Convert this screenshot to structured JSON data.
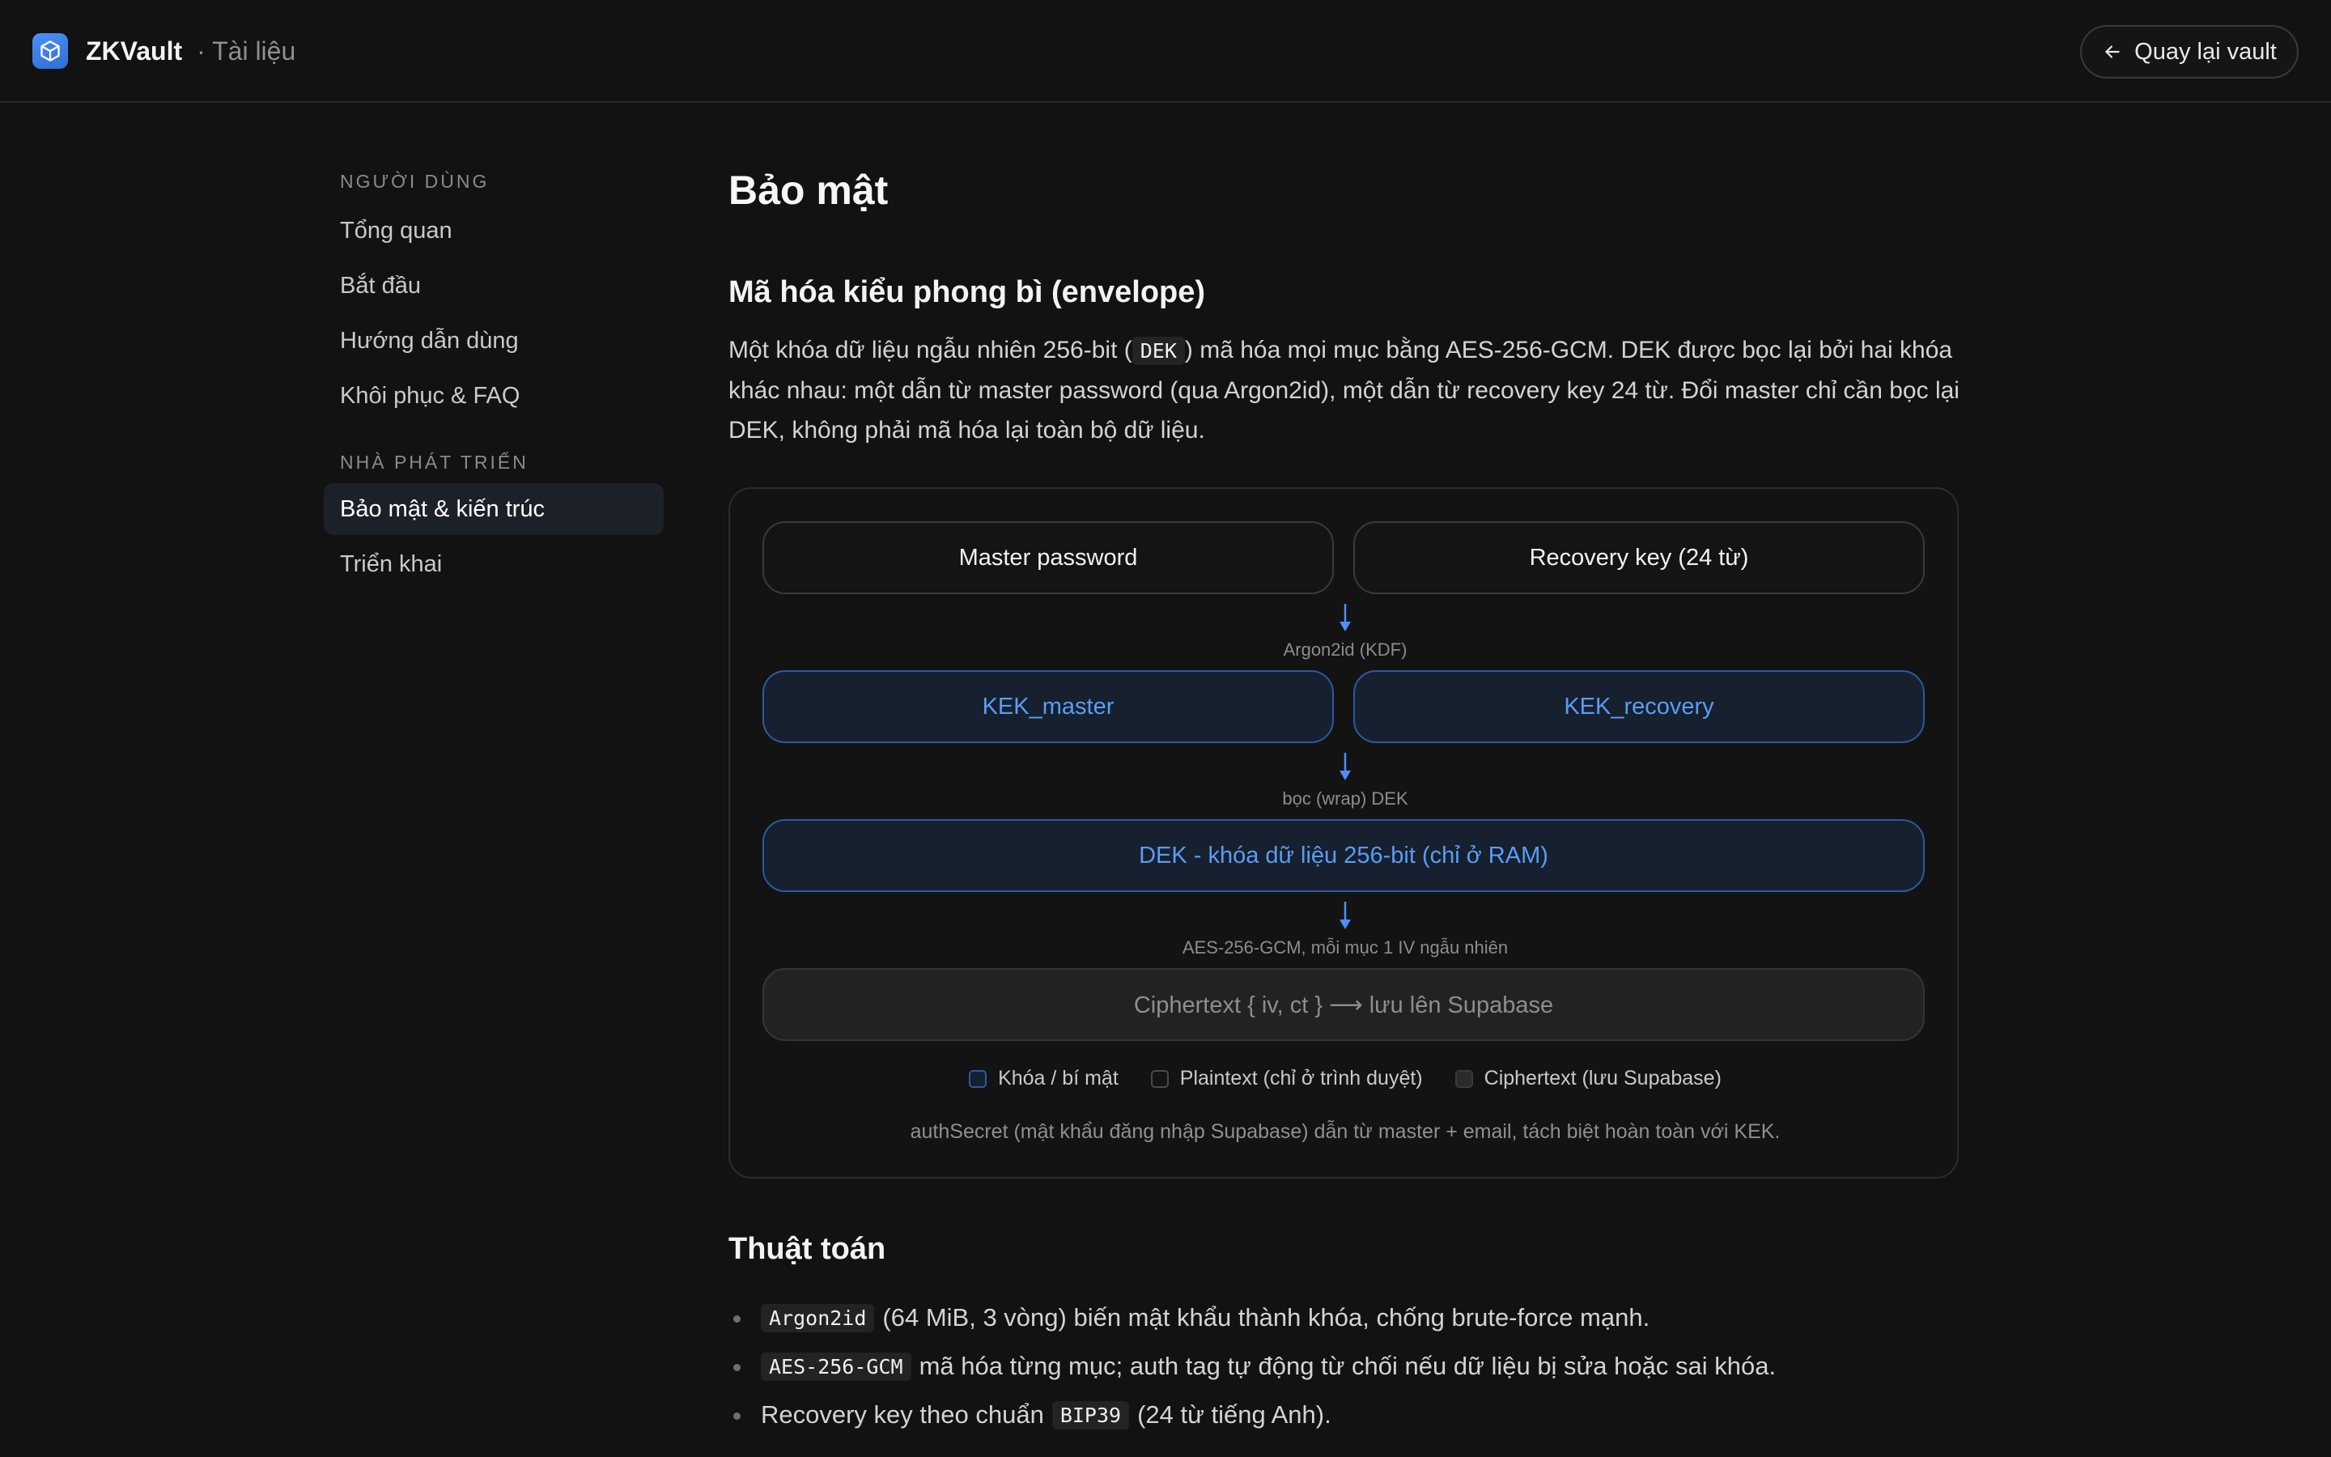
{
  "header": {
    "brand": "ZKVault",
    "section": "· Tài liệu",
    "back_label": "Quay lại vault"
  },
  "sidebar": {
    "groups": [
      {
        "title": "NGƯỜI DÙNG",
        "items": [
          "Tổng quan",
          "Bắt đầu",
          "Hướng dẫn dùng",
          "Khôi phục & FAQ"
        ]
      },
      {
        "title": "NHÀ PHÁT TRIỂN",
        "items": [
          "Bảo mật & kiến trúc",
          "Triển khai"
        ]
      }
    ],
    "active_item": "Bảo mật & kiến trúc"
  },
  "main": {
    "title": "Bảo mật",
    "envelope": {
      "heading": "Mã hóa kiểu phong bì (envelope)",
      "para_before_code": "Một khóa dữ liệu ngẫu nhiên 256-bit (",
      "code": "DEK",
      "para_after_code": ") mã hóa mọi mục bằng AES-256-GCM. DEK được bọc lại bởi hai khóa khác nhau: một dẫn từ master password (qua Argon2id), một dẫn từ recovery key 24 từ. Đổi master chỉ cần bọc lại DEK, không phải mã hóa lại toàn bộ dữ liệu."
    },
    "diagram": {
      "master_password": "Master password",
      "recovery_key": "Recovery key (24 từ)",
      "step1_label": "Argon2id (KDF)",
      "kek_master": "KEK_master",
      "kek_recovery": "KEK_recovery",
      "step2_label": "bọc (wrap) DEK",
      "dek": "DEK - khóa dữ liệu 256-bit (chỉ ở RAM)",
      "step3_label": "AES-256-GCM, mỗi mục 1 IV ngẫu nhiên",
      "ciphertext": "Ciphertext { iv, ct } ⟶ lưu lên Supabase",
      "legend": [
        "Khóa / bí mật",
        "Plaintext (chỉ ở trình duyệt)",
        "Ciphertext (lưu Supabase)"
      ],
      "note": "authSecret (mật khẩu đăng nhập Supabase) dẫn từ master + email, tách biệt hoàn toàn với KEK.",
      "colors": {
        "key_border": "#2b5aa0",
        "key_text": "#5b9cf5",
        "arrow": "#4d8ff5"
      }
    },
    "algorithms": {
      "heading": "Thuật toán",
      "items": [
        {
          "code": "Argon2id",
          "text": "(64 MiB, 3 vòng) biến mật khẩu thành khóa, chống brute-force mạnh."
        },
        {
          "code": "AES-256-GCM",
          "text": "mã hóa từng mục; auth tag tự động từ chối nếu dữ liệu bị sửa hoặc sai khóa."
        },
        {
          "before": "Recovery key theo chuẩn",
          "code": "BIP39",
          "after": "(24 từ tiếng Anh)."
        }
      ]
    }
  }
}
